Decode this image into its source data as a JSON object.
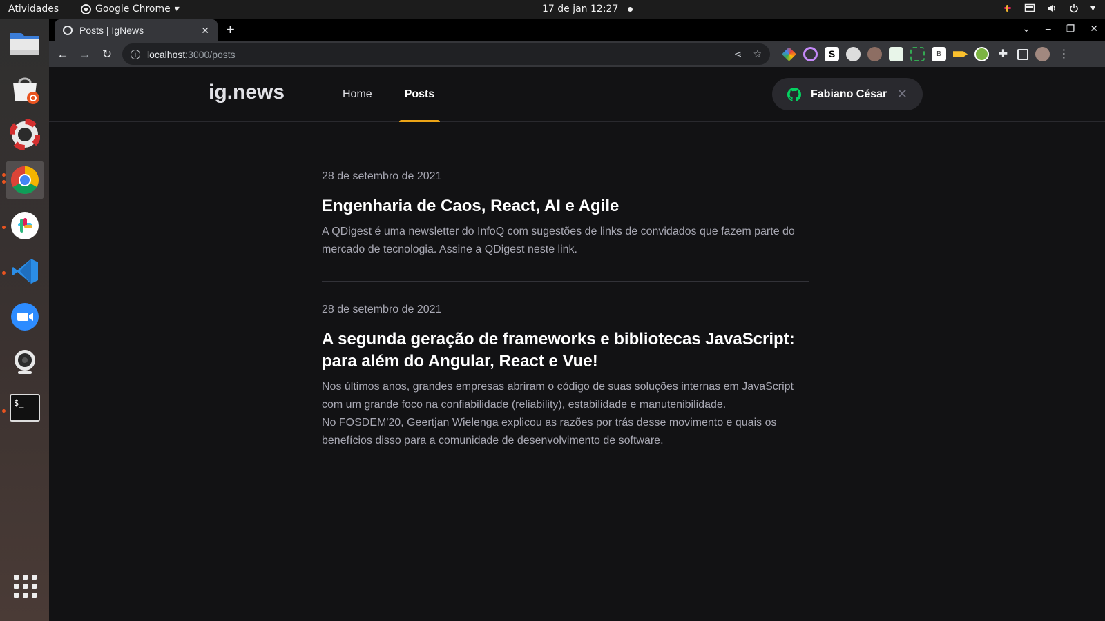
{
  "system": {
    "activities": "Atividades",
    "app_menu": "Google Chrome",
    "clock": "17 de jan  12:27"
  },
  "dock": {
    "items": [
      "files-icon",
      "software-icon",
      "help-icon",
      "chrome-icon",
      "slack-icon",
      "vscode-icon",
      "zoom-icon",
      "webcam-icon",
      "terminal-icon"
    ]
  },
  "browser": {
    "tab_title": "Posts | IgNews",
    "url_host": "localhost",
    "url_path": ":3000/posts"
  },
  "site": {
    "logo": "ig.news",
    "nav": [
      {
        "label": "Home",
        "active": false
      },
      {
        "label": "Posts",
        "active": true
      }
    ],
    "user_name": "Fabiano César",
    "accent_color": "#eba417"
  },
  "posts": [
    {
      "date": "28 de setembro de 2021",
      "title": "Engenharia de Caos, React, AI e Agile",
      "excerpt": "A QDigest é uma newsletter do InfoQ com sugestões de links de convidados que fazem parte do mercado de tecnologia. Assine a QDigest neste link."
    },
    {
      "date": "28 de setembro de 2021",
      "title": "A segunda geração de frameworks e bibliotecas JavaScript: para além do Angular, React e Vue!",
      "excerpt": "Nos últimos anos, grandes empresas abriram o código de suas soluções internas em JavaScript com um grande foco na confiabilidade (reliability), estabilidade e manutenibilidade.",
      "excerpt2": "No FOSDEM'20, Geertjan Wielenga explicou as razões por trás desse movimento e quais os benefícios disso para a comunidade de desenvolvimento de software."
    }
  ]
}
